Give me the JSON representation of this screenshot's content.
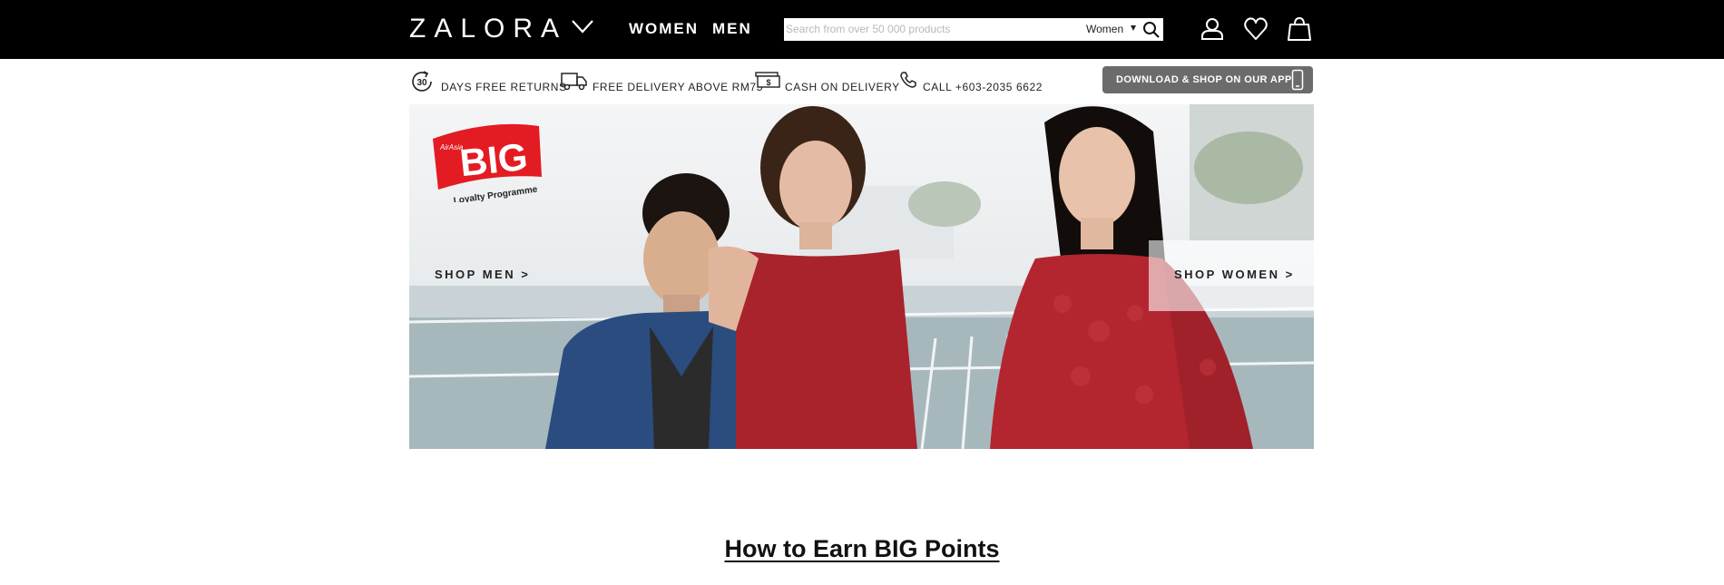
{
  "header": {
    "logo": "ZALORA",
    "nav": {
      "women": "WOMEN",
      "men": "MEN"
    },
    "search": {
      "placeholder": "Search from over 50 000 products",
      "category": "Women"
    }
  },
  "usp": {
    "returns_badge": "30",
    "returns": "DAYS FREE RETURNS",
    "delivery": "FREE DELIVERY ABOVE RM75",
    "cash_symbol": "$",
    "cash": "CASH ON DELIVERY",
    "call": "CALL +603-2035 6622",
    "app_button": "DOWNLOAD & SHOP ON OUR APP"
  },
  "hero": {
    "logo_airasia": "AirAsia",
    "logo_big": "BIG",
    "logo_tagline": "Loyalty Programme",
    "shop_men": "SHOP MEN >",
    "shop_women": "SHOP WOMEN >"
  },
  "section": {
    "title": "How to Earn BIG Points"
  },
  "colors": {
    "header_bg": "#000000",
    "accent_red": "#e31b23",
    "dress_red": "#a8232c",
    "denim": "#2a4c7f"
  }
}
